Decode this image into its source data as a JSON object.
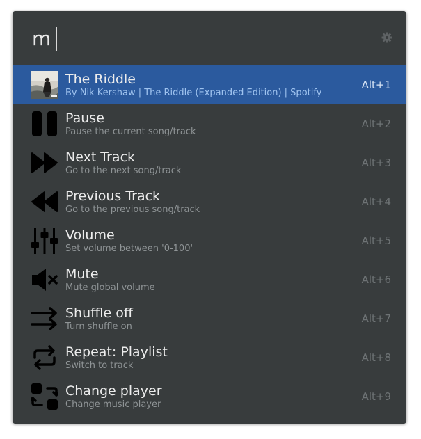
{
  "search": {
    "query": "m"
  },
  "icons": {
    "settings": "gear-icon"
  },
  "colors": {
    "panel": "#383c3d",
    "selected": "#2b5a9e",
    "title": "#ececec",
    "description": "#8f9496",
    "shortcut": "#6e7375"
  },
  "results": [
    {
      "title": "The Riddle",
      "description": "By Nik Kershaw | The Riddle (Expanded Edition) | Spotify",
      "shortcut": "Alt+1",
      "icon": "album-art",
      "selected": true
    },
    {
      "title": "Pause",
      "description": "Pause the current song/track",
      "shortcut": "Alt+2",
      "icon": "pause-icon"
    },
    {
      "title": "Next Track",
      "description": "Go to the next song/track",
      "shortcut": "Alt+3",
      "icon": "next-track-icon"
    },
    {
      "title": "Previous Track",
      "description": "Go to the previous song/track",
      "shortcut": "Alt+4",
      "icon": "previous-track-icon"
    },
    {
      "title": "Volume",
      "description": "Set volume between '0-100'",
      "shortcut": "Alt+5",
      "icon": "volume-sliders-icon"
    },
    {
      "title": "Mute",
      "description": "Mute global volume",
      "shortcut": "Alt+6",
      "icon": "mute-icon"
    },
    {
      "title": "Shuffle off",
      "description": "Turn shuffle on",
      "shortcut": "Alt+7",
      "icon": "shuffle-off-icon"
    },
    {
      "title": "Repeat: Playlist",
      "description": "Switch to track",
      "shortcut": "Alt+8",
      "icon": "repeat-icon"
    },
    {
      "title": "Change player",
      "description": "Change music player",
      "shortcut": "Alt+9",
      "icon": "change-player-icon"
    }
  ]
}
